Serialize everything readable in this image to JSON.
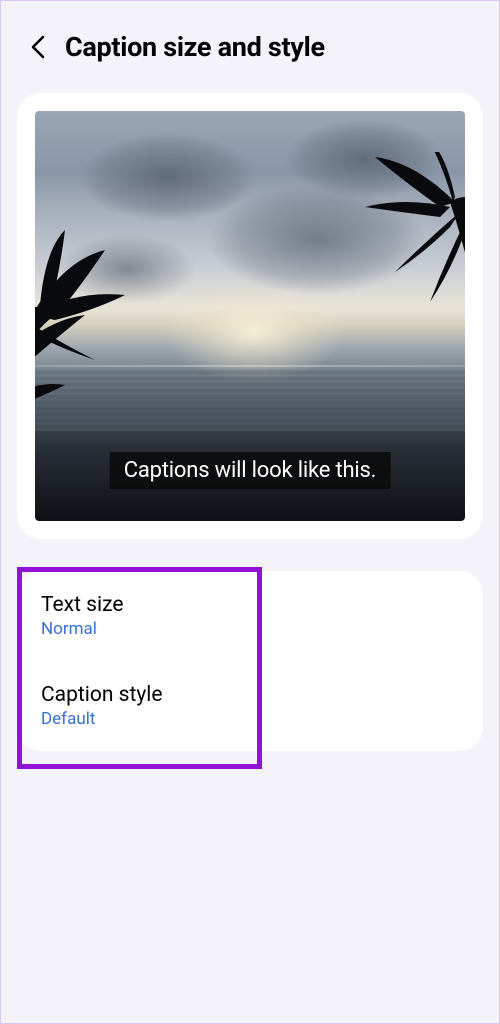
{
  "header": {
    "title": "Caption size and style"
  },
  "preview": {
    "caption_text": "Captions will look like this."
  },
  "settings": {
    "text_size": {
      "label": "Text size",
      "value": "Normal"
    },
    "caption_style": {
      "label": "Caption style",
      "value": "Default"
    }
  }
}
